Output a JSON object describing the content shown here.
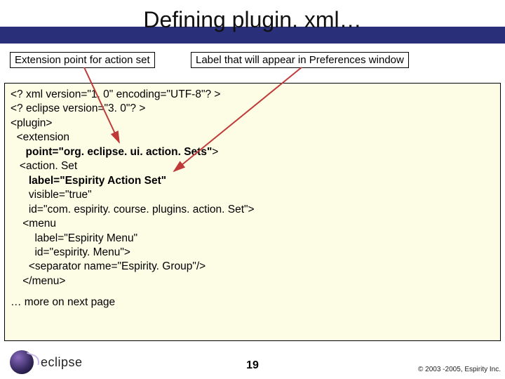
{
  "title": "Defining plugin. xml…",
  "callouts": {
    "left": "Extension point for action set",
    "right": "Label that will appear in Preferences window"
  },
  "code": {
    "l1": "<? xml version=\"1. 0\" encoding=\"UTF-8\"? >",
    "l2": "<? eclipse version=\"3. 0\"? >",
    "l3": "<plugin>",
    "l4": "  <extension",
    "l5a": "     point=\"org. eclipse. ui. action. Sets\"",
    "l5b": ">",
    "l6": "   <action. Set",
    "l7a": "      ",
    "l7b": "label=\"Espirity Action Set\"",
    "l8": "      visible=\"true\"",
    "l9": "      id=\"com. espirity. course. plugins. action. Set\">",
    "l10": "    <menu",
    "l11": "        label=\"Espirity Menu\"",
    "l12": "        id=\"espirity. Menu\">",
    "l13": "      <separator name=\"Espirity. Group\"/>",
    "l14": "    </menu>",
    "more": "… more on next page"
  },
  "logo_text": "eclipse",
  "page_number": "19",
  "copyright": "© 2003 -2005, Espirity Inc."
}
